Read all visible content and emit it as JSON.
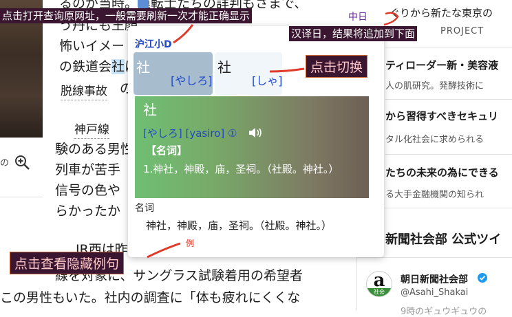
{
  "article": {
    "line1": "るのが当時。運転士たちの詳判もさまで、",
    "line2": "う丹にも王顔",
    "line3": "怖いイメー",
    "line4_before": "の鉄道会",
    "line4_highlight": "社",
    "line4_after": "は",
    "ruby_word1": "脱線事故",
    "ruby_word1_tail": "の",
    "ruby_word2": "神戸線",
    "line5": "験のある男性",
    "line6": "列車が苦手",
    "line7": "信号の色や",
    "line8": "らかったか",
    "line9": "JR西は昨",
    "line10": "線を対象に、サングラス試験着用の希望者",
    "line11": "この男性もいた。社内の調査に「体も疲れにくくな",
    "photo_caption": "の"
  },
  "right_column": {
    "item1_title": "ぐりから新たな東京の",
    "item1_sub": "PROJECT",
    "item2_title": "ティローダー新・美容液",
    "item2_sub": "人の肌研究。発酵技術に",
    "item3_title": "から習得すべきセキュリ",
    "item3_sub": "タル化社会に求められる",
    "item4_title": "たちの未来の為にできる",
    "item4_sub": "る大手金融機関の知られ",
    "section_title": "新聞社会部 公式ツイ",
    "account_name": "朝日新聞社会部",
    "account_handle": "@Asahi_Shakai",
    "logo_letter": "a",
    "logo_label": "社会",
    "bottom_text": "9時のギュウギュウの"
  },
  "popup": {
    "source_name": "沪江小D",
    "tab1_word": "社",
    "tab1_kana": "[やしろ]",
    "tab2_word": "社",
    "tab2_kana": "[しゃ]",
    "entry_word": "社",
    "entry_pron": "[やしろ] [yasiro] ①",
    "entry_pos": "【名词】",
    "entry_def": "1.神社，神殿，庙，圣祠。（社殿。神社。）",
    "def_pos": "名词",
    "def_text": "神社，神殿，庙，圣祠。（社殿。神社。）",
    "example_link": "例"
  },
  "annotations": {
    "top_left": "点击打开查询原网址，一般需要刷新一次才能正确显示",
    "top_right_tag": "中日",
    "top_right": "汉译日，结果将追加到下面",
    "switch": "点击切换",
    "examples": "点击查看隐藏例句"
  },
  "colors": {
    "annotation_bg": "#3b1630",
    "arrow_red": "#e03a2a",
    "link_blue": "#1f47c8"
  }
}
